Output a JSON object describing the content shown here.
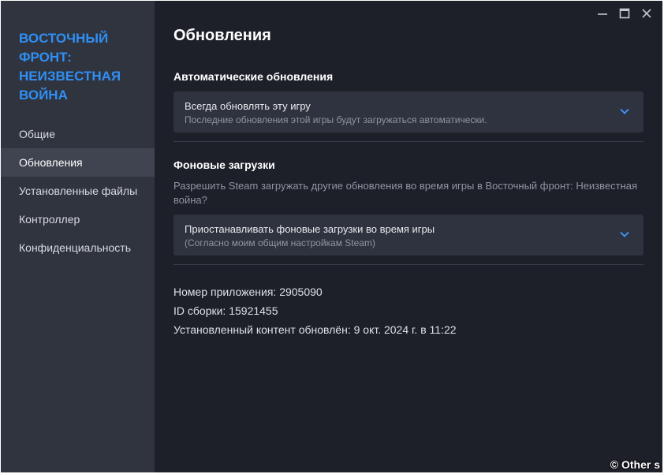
{
  "window": {
    "controls": {
      "minimize_icon": "minimize-icon",
      "maximize_icon": "maximize-icon",
      "close_icon": "close-icon"
    }
  },
  "sidebar": {
    "game_title": "ВОСТОЧНЫЙ ФРОНТ: НЕИЗВЕСТНАЯ ВОЙНА",
    "items": [
      {
        "label": "Общие",
        "active": false
      },
      {
        "label": "Обновления",
        "active": true
      },
      {
        "label": "Установленные файлы",
        "active": false
      },
      {
        "label": "Контроллер",
        "active": false
      },
      {
        "label": "Конфиденциальность",
        "active": false
      }
    ]
  },
  "main": {
    "title": "Обновления",
    "auto_updates": {
      "heading": "Автоматические обновления",
      "dropdown": {
        "value": "Всегда обновлять эту игру",
        "description": "Последние обновления этой игры будут загружаться автоматически."
      }
    },
    "background_downloads": {
      "heading": "Фоновые загрузки",
      "description": "Разрешить Steam загружать другие обновления во время игры в Восточный фронт: Неизвестная война?",
      "dropdown": {
        "value": "Приостанавливать фоновые загрузки во время игры",
        "description": "(Согласно моим общим настройкам Steam)"
      }
    },
    "info": {
      "app_id": "Номер приложения: 2905090",
      "build_id": "ID сборки: 15921455",
      "content_updated": "Установленный контент обновлён: 9 окт. 2024 г. в 11:22"
    }
  },
  "watermark": "© Other s",
  "colors": {
    "accent": "#2f8ff5",
    "background": "#1d2029",
    "sidebar": "#30343f",
    "sidebar_active": "#3f4450",
    "dropdown": "#2f3340",
    "chevron": "#3d9bff"
  }
}
